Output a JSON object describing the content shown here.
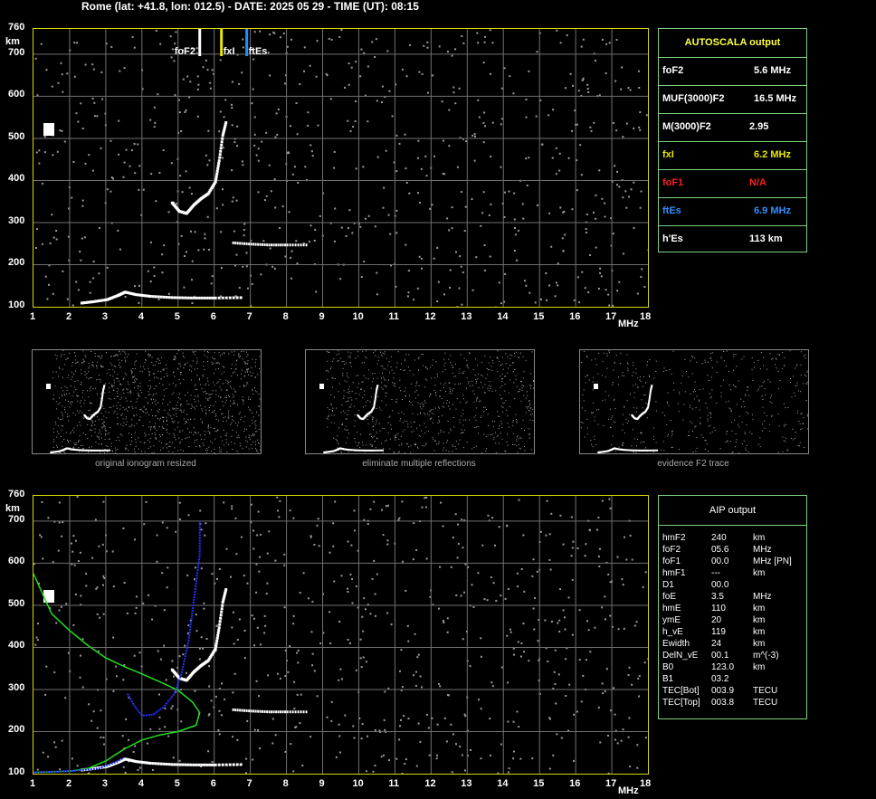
{
  "header": {
    "text": "Rome (lat: +41.8, lon: 012.5) - DATE: 2025 05 29 - TIME (UT): 08:15"
  },
  "chart_data": [
    {
      "type": "scatter",
      "xlabel": "MHz",
      "ylabel": "km",
      "xlim": [
        1,
        18
      ],
      "ylim": [
        100,
        760
      ],
      "x_ticks": [
        "1",
        "2",
        "3",
        "4",
        "5",
        "6",
        "7",
        "8",
        "9",
        "10",
        "11",
        "12",
        "13",
        "14",
        "15",
        "16",
        "17",
        "18"
      ],
      "y_ticks": [
        "100",
        "200",
        "300",
        "400",
        "500",
        "600",
        "700",
        "760"
      ],
      "markers": [
        {
          "label": "foF2",
          "x": 5.6,
          "color": "#ffffff"
        },
        {
          "label": "fxI",
          "x": 6.2,
          "color": "#e8e800"
        },
        {
          "label": "ftEs",
          "x": 6.9,
          "color": "#1e90ff"
        }
      ],
      "traces": {
        "e_layer": [
          [
            2.3,
            112
          ],
          [
            2.6,
            115
          ],
          [
            3.0,
            120
          ],
          [
            3.3,
            130
          ],
          [
            3.5,
            138
          ],
          [
            3.8,
            132
          ],
          [
            4.2,
            128
          ],
          [
            4.8,
            125
          ],
          [
            5.4,
            124
          ],
          [
            6.0,
            124
          ],
          [
            6.8,
            125
          ]
        ],
        "f_layer": [
          [
            4.8,
            350
          ],
          [
            5.0,
            330
          ],
          [
            5.2,
            325
          ],
          [
            5.4,
            345
          ],
          [
            5.6,
            360
          ],
          [
            5.8,
            372
          ],
          [
            6.0,
            400
          ],
          [
            6.1,
            450
          ],
          [
            6.2,
            510
          ],
          [
            6.3,
            545
          ]
        ],
        "es_multiple": [
          [
            6.5,
            255
          ],
          [
            7.0,
            252
          ],
          [
            7.5,
            250
          ],
          [
            8.0,
            250
          ],
          [
            8.6,
            250
          ]
        ]
      }
    },
    {
      "type": "scatter",
      "xlabel": "MHz",
      "ylabel": "km",
      "xlim": [
        1,
        18
      ],
      "ylim": [
        100,
        760
      ],
      "x_ticks": [
        "1",
        "2",
        "3",
        "4",
        "5",
        "6",
        "7",
        "8",
        "9",
        "10",
        "11",
        "12",
        "13",
        "14",
        "15",
        "16",
        "17",
        "18"
      ],
      "y_ticks": [
        "100",
        "200",
        "300",
        "400",
        "500",
        "600",
        "700",
        "760"
      ],
      "series": [
        {
          "values": [
            [
              1.0,
              575
            ],
            [
              1.5,
              480
            ],
            [
              2.0,
              440
            ],
            [
              2.5,
              405
            ],
            [
              3.0,
              375
            ],
            [
              3.5,
              355
            ],
            [
              4.0,
              337
            ],
            [
              4.5,
              318
            ],
            [
              5.0,
              298
            ],
            [
              5.4,
              270
            ],
            [
              5.6,
              245
            ],
            [
              5.5,
              215
            ],
            [
              5.0,
              200
            ],
            [
              4.5,
              192
            ],
            [
              4.0,
              180
            ],
            [
              3.5,
              158
            ],
            [
              3.0,
              130
            ],
            [
              2.5,
              112
            ],
            [
              2.0,
              106
            ],
            [
              1.0,
              103
            ]
          ],
          "color": "#22dd22"
        },
        {
          "values": [
            [
              3.6,
              290
            ],
            [
              3.8,
              260
            ],
            [
              4.0,
              238
            ],
            [
              4.3,
              240
            ],
            [
              4.6,
              258
            ],
            [
              4.9,
              290
            ],
            [
              5.1,
              340
            ],
            [
              5.3,
              420
            ],
            [
              5.45,
              520
            ],
            [
              5.6,
              620
            ],
            [
              5.6,
              700
            ]
          ],
          "color": "#2233ff"
        },
        {
          "values": [
            [
              1.0,
              103
            ],
            [
              2.0,
              106
            ],
            [
              2.8,
              112
            ],
            [
              3.3,
              128
            ],
            [
              3.5,
              138
            ]
          ],
          "color": "#2233ff"
        }
      ]
    }
  ],
  "autoscala": {
    "title": "AUTOSCALA output",
    "rows": [
      {
        "label": "foF2",
        "value": "5.6 MHz",
        "color": "#ffffff"
      },
      {
        "label": "MUF(3000)F2",
        "value": "16.5 MHz",
        "color": "#ffffff"
      },
      {
        "label": "M(3000)F2",
        "value": "2.95",
        "color": "#ffffff"
      },
      {
        "label": "fxI",
        "value": "6.2 MHz",
        "color": "#e8e800"
      },
      {
        "label": "foF1",
        "value": "N/A",
        "color": "#ff2020"
      },
      {
        "label": "ftEs",
        "value": "6.9 MHz",
        "color": "#2f8fff"
      },
      {
        "label": "h'Es",
        "value": "113    km",
        "color": "#ffffff"
      }
    ]
  },
  "thumbnails": [
    {
      "caption": "original ionogram resized"
    },
    {
      "caption": "eliminate multiple reflections"
    },
    {
      "caption": "evidence F2 trace"
    }
  ],
  "aip": {
    "title": "AIP output",
    "rows": [
      {
        "name": "hmF2",
        "value": "240",
        "unit": "km"
      },
      {
        "name": "foF2",
        "value": "05.6",
        "unit": "MHz"
      },
      {
        "name": "foF1",
        "value": "00.0",
        "unit": "MHz    [PN]"
      },
      {
        "name": "hmF1",
        "value": "---",
        "unit": "km"
      },
      {
        "name": "D1",
        "value": "00.0",
        "unit": ""
      },
      {
        "name": "foE",
        "value": "3.5",
        "unit": "MHz"
      },
      {
        "name": "hmE",
        "value": "110",
        "unit": "km"
      },
      {
        "name": "ymE",
        "value": "20",
        "unit": "km"
      },
      {
        "name": "h_vE",
        "value": "119",
        "unit": "km"
      },
      {
        "name": "Ewidth",
        "value": "24",
        "unit": "km"
      },
      {
        "name": "DelN_vE",
        "value": "00.1",
        "unit": "m^(-3)"
      },
      {
        "name": "B0",
        "value": "123.0",
        "unit": "km"
      },
      {
        "name": "B1",
        "value": "03.2",
        "unit": ""
      },
      {
        "name": "TEC[Bot]",
        "value": "003.9",
        "unit": "TECU"
      },
      {
        "name": "TEC[Top]",
        "value": "003.8",
        "unit": "TECU"
      }
    ]
  }
}
